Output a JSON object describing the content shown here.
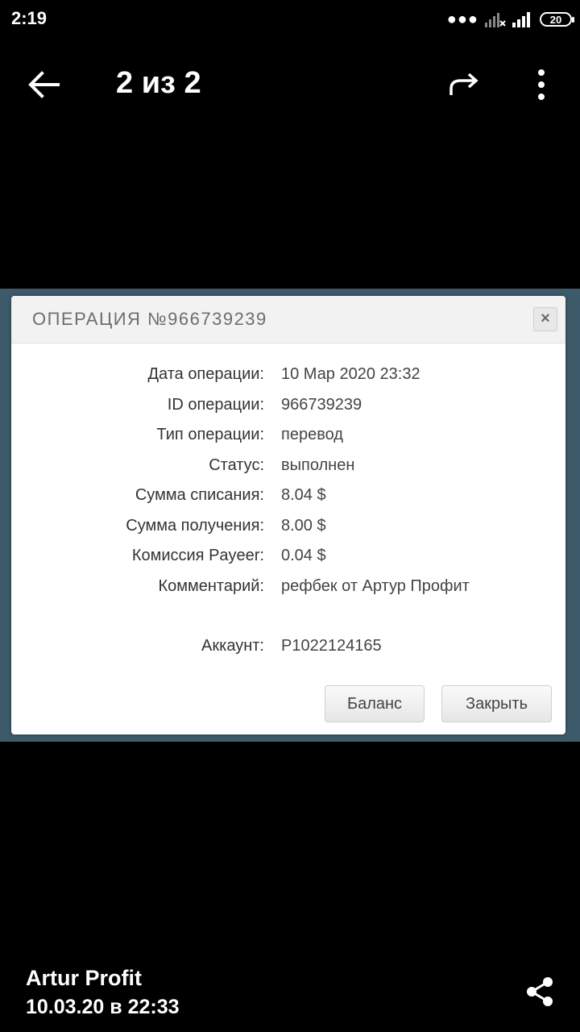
{
  "status_bar": {
    "time": "2:19",
    "battery": "20"
  },
  "toolbar": {
    "page_counter": "2 из 2",
    "back_icon": "arrow-left-icon",
    "forward_icon": "forward-icon",
    "more_icon": "more-vert-icon"
  },
  "dialog": {
    "title": "ОПЕРАЦИЯ №966739239",
    "close_symbol": "×",
    "rows": [
      {
        "label": "Дата операции:",
        "value": "10 Мар 2020 23:32"
      },
      {
        "label": "ID операции:",
        "value": "966739239"
      },
      {
        "label": "Тип операции:",
        "value": "перевод"
      },
      {
        "label": "Статус:",
        "value": "выполнен"
      },
      {
        "label": "Сумма списания:",
        "value": "8.04 $"
      },
      {
        "label": "Сумма получения:",
        "value": "8.00 $"
      },
      {
        "label": "Комиссия Payeer:",
        "value": "0.04 $"
      },
      {
        "label": "Комментарий:",
        "value": "рефбек от Артур Профит"
      }
    ],
    "account": {
      "label": "Аккаунт:",
      "value": "P1022124165"
    },
    "buttons": {
      "balance": "Баланс",
      "close": "Закрыть"
    }
  },
  "caption": {
    "name": "Artur Profit",
    "date": "10.03.20 в 22:33"
  },
  "colors": {
    "image_background": "#3d5a6b",
    "dialog_header": "#f2f2f2"
  }
}
